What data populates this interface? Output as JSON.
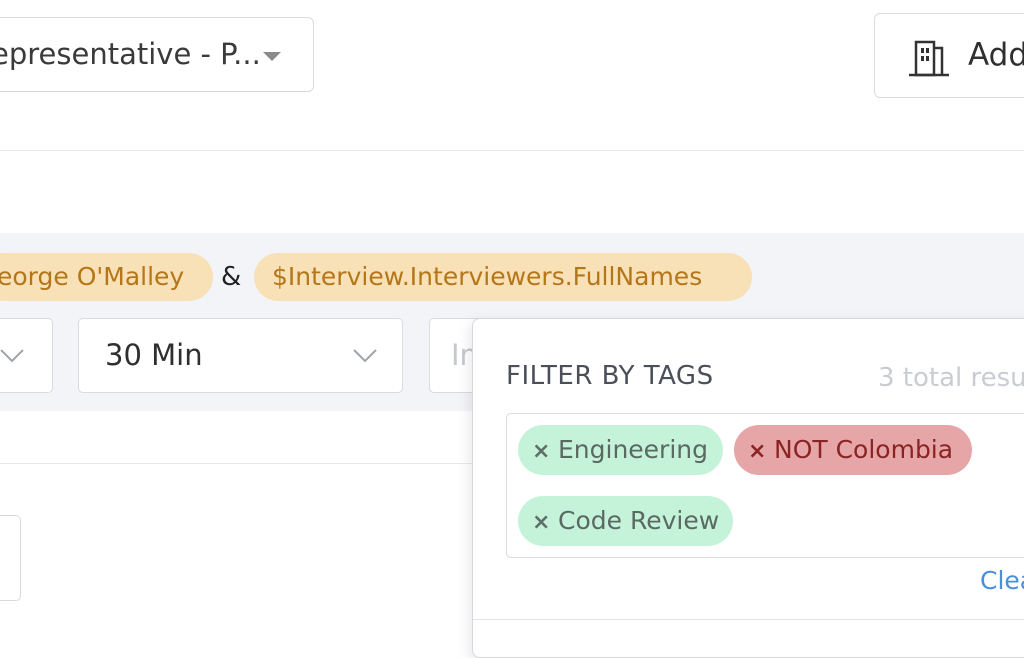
{
  "header": {
    "role_select": {
      "value": "epresentative - P..."
    },
    "add_button": {
      "label": "Add"
    }
  },
  "invite": {
    "name_tag": "eorge O'Malley",
    "separator": "&",
    "variable_tag": "$Interview.Interviewers.FullNames",
    "duration_select": {
      "value": "30 Min"
    },
    "input_placeholder": "In"
  },
  "filter_popover": {
    "title": "FILTER BY TAGS",
    "result_count": "3 total resu",
    "tags": [
      {
        "label": "Engineering",
        "type": "include"
      },
      {
        "label": "NOT Colombia",
        "type": "exclude"
      },
      {
        "label": "Code Review",
        "type": "include"
      }
    ],
    "remove_symbol": "×",
    "clear_link": "Clea"
  },
  "icons": {
    "add": "building-icon",
    "dropdown": "caret-down-icon",
    "select": "chevron-down-icon",
    "remove": "close-icon"
  },
  "colors": {
    "variable_tag_bg": "#f8e1b6",
    "variable_tag_text": "#b5761a",
    "include_tag_bg": "#c5f3da",
    "exclude_tag_bg": "#e6a6a8",
    "link": "#4a90d9"
  }
}
